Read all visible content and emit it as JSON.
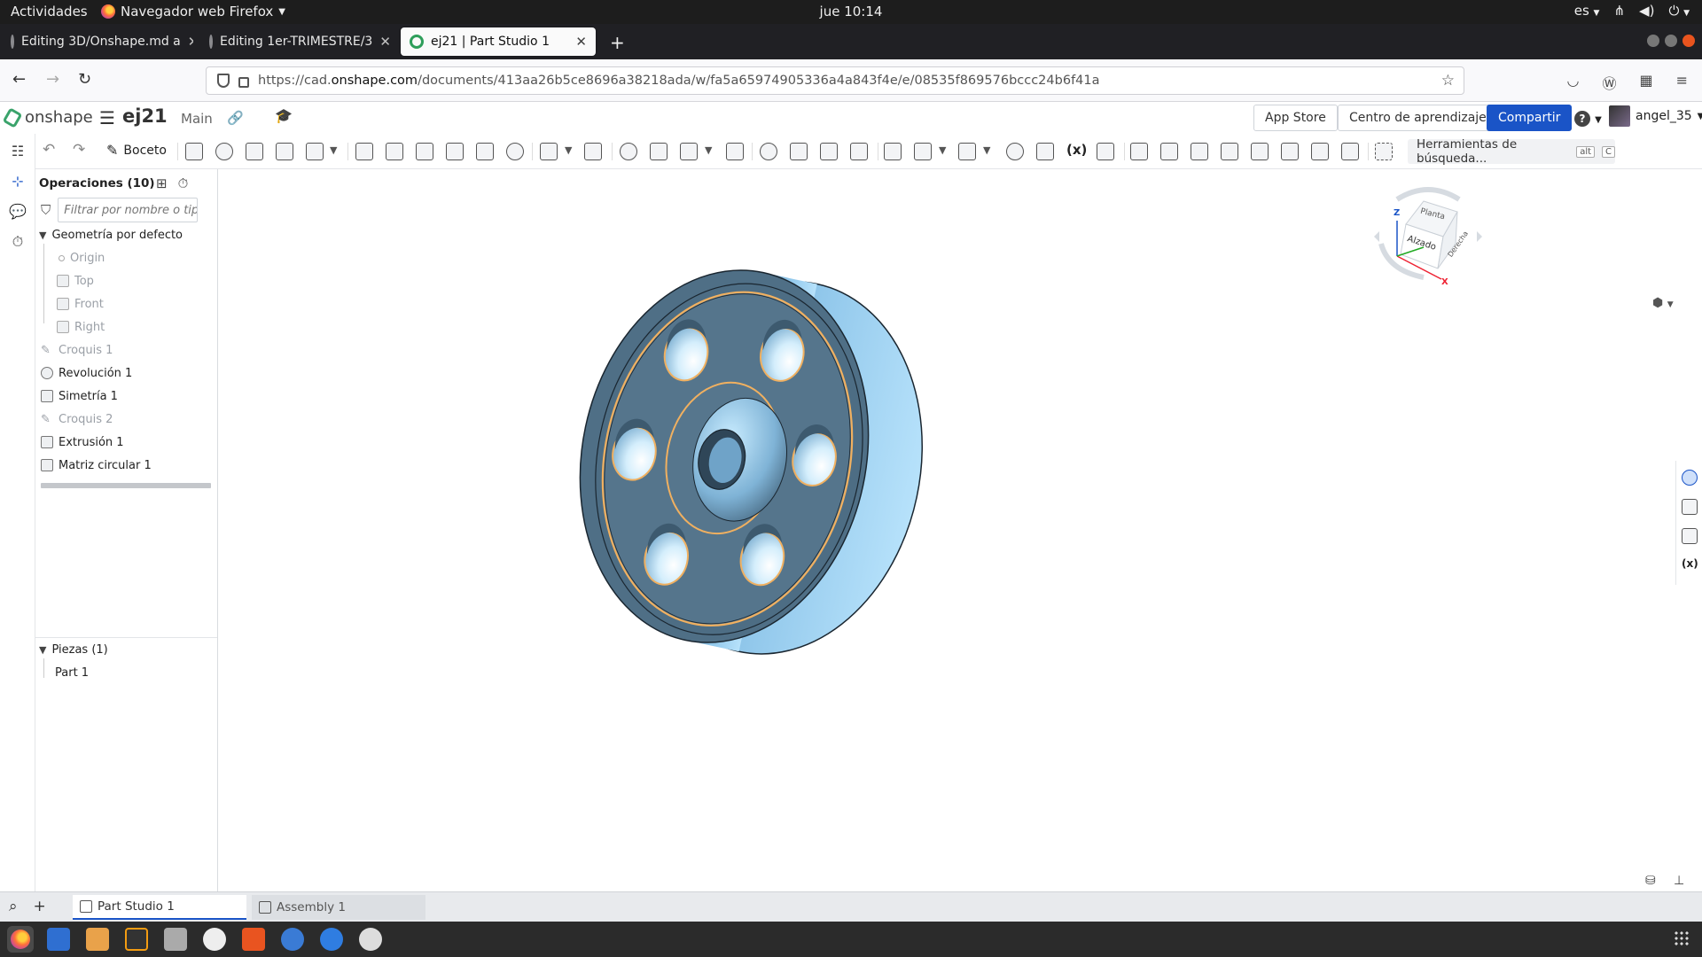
{
  "gnome": {
    "activities": "Actividades",
    "app_menu": "Navegador web Firefox",
    "clock": "jue 10:14",
    "lang": "es"
  },
  "browser": {
    "tabs": [
      {
        "label": "Editing 3D/Onshape.md a",
        "icon": "github-icon"
      },
      {
        "label": "Editing 1er-TRIMESTRE/3",
        "icon": "github-icon"
      },
      {
        "label": "ej21 | Part Studio 1",
        "icon": "onshape-icon",
        "active": true
      }
    ],
    "url_prefix": "https://cad.",
    "url_domain": "onshape.com",
    "url_path": "/documents/413aa26b5ce8696a38218ada/w/fa5a65974905336a4a843f4e/e/08535f869576bccc24b6f41a"
  },
  "onshape": {
    "logo_text": "onshape",
    "doc_name": "ej21",
    "branch": "Main",
    "header_buttons": {
      "app_store": "App Store",
      "learning": "Centro de aprendizaje",
      "share": "Compartir"
    },
    "help": "?",
    "user": "angel_35"
  },
  "toolbar": {
    "sketch_label": "Boceto",
    "search_tools_label": "Herramientas de búsqueda...",
    "search_tools_shortcut_1": "alt",
    "search_tools_shortcut_2": "C"
  },
  "features": {
    "header": "Operaciones (10)",
    "filter_placeholder": "Filtrar por nombre o tip",
    "items": [
      {
        "label": "Geometría por defecto",
        "kind": "group"
      },
      {
        "label": "Origin",
        "kind": "origin"
      },
      {
        "label": "Top",
        "kind": "plane"
      },
      {
        "label": "Front",
        "kind": "plane"
      },
      {
        "label": "Right",
        "kind": "plane"
      },
      {
        "label": "Croquis 1",
        "kind": "sketch"
      },
      {
        "label": "Revolución 1",
        "kind": "revolve"
      },
      {
        "label": "Simetría 1",
        "kind": "mirror"
      },
      {
        "label": "Croquis 2",
        "kind": "sketch"
      },
      {
        "label": "Extrusión 1",
        "kind": "extrude"
      },
      {
        "label": "Matriz circular 1",
        "kind": "pattern"
      }
    ],
    "parts_header": "Piezas (1)",
    "parts": [
      "Part 1"
    ]
  },
  "viewcube": {
    "top_label": "Planta",
    "front_label": "Alzado",
    "right_label": "Derecha",
    "axis_z": "Z",
    "axis_x": "X"
  },
  "bottom_tabs": [
    {
      "label": "Part Studio 1",
      "active": true
    },
    {
      "label": "Assembly 1",
      "active": false
    }
  ],
  "colors": {
    "part_body": "#4f6f86",
    "part_highlight": "#9fd3f3",
    "edge_highlight": "#f0b060",
    "brand_blue": "#1a54c7",
    "onshape_green": "#3aa36b"
  }
}
